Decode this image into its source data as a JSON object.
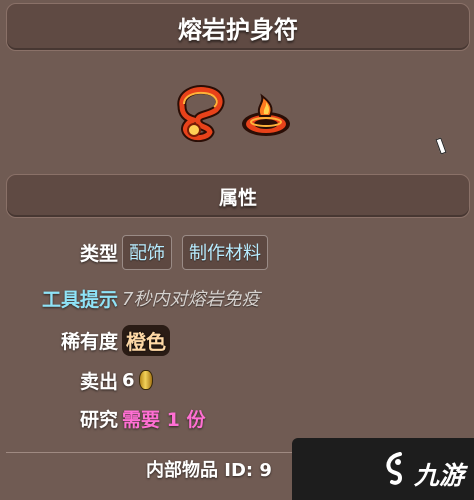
{
  "header": {
    "title": "熔岩护身符"
  },
  "icons": [
    "lava-charm-icon",
    "lava-charm-ornament-icon"
  ],
  "section": {
    "title": "属性"
  },
  "properties": {
    "type": {
      "label": "类型",
      "tags": [
        "配饰",
        "制作材料"
      ]
    },
    "tooltip": {
      "label": "工具提示",
      "text": "7秒内对熔岩免疫"
    },
    "rarity": {
      "label": "稀有度",
      "value": "橙色"
    },
    "sell": {
      "label": "卖出",
      "value": "6",
      "icon": "gold-coin-icon"
    },
    "research": {
      "label": "研究",
      "value": "需要 1 份"
    }
  },
  "footer": {
    "internal_id": "内部物品 ID: 9"
  },
  "watermark": {
    "text": "九游",
    "icon": "jiuyou-logo-icon"
  },
  "colors": {
    "background": "#705b53",
    "label_cyan": "#8fe3f7",
    "tag_text": "#b8ecff",
    "rarity": "#ffd9a6",
    "research": "#ff6fd3"
  }
}
